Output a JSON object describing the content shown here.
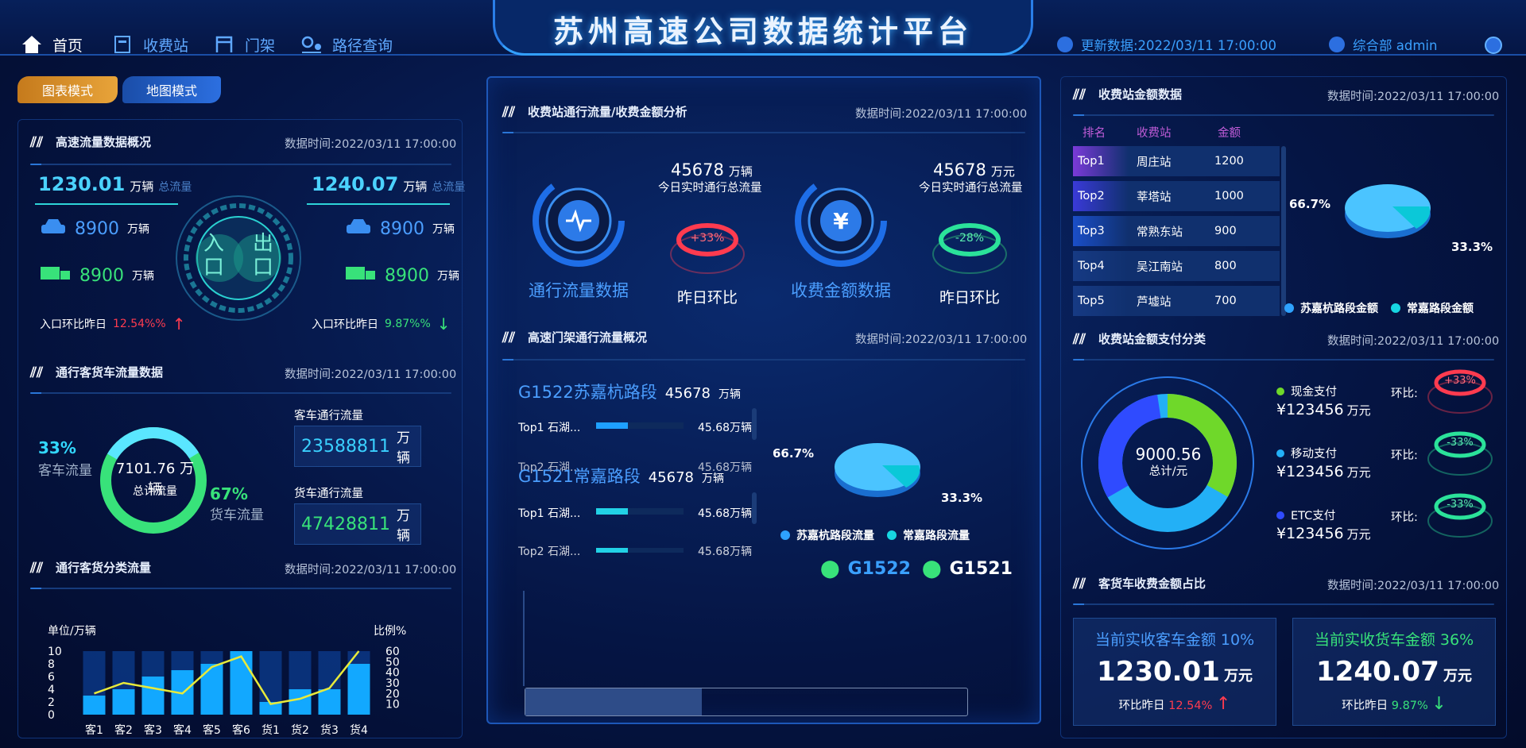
{
  "header": {
    "title": "苏州高速公司数据统计平台",
    "nav": [
      {
        "label": "首页"
      },
      {
        "label": "收费站"
      },
      {
        "label": "门架"
      },
      {
        "label": "路径查询"
      }
    ],
    "update_label": "更新数据:2022/03/11 17:00:00",
    "user": "综合部 admin"
  },
  "modes": {
    "chart": "图表模式",
    "map": "地图模式"
  },
  "left": {
    "overview": {
      "title": "高速流量数据概况",
      "time": "数据时间:2022/03/11 17:00:00",
      "in_total": "1230.01",
      "out_total": "1240.07",
      "unit": "万辆",
      "total_label": "总流量",
      "car_in": "8900",
      "car_out": "8900",
      "truck_in": "8900",
      "truck_out": "8900",
      "unit2": "万辆",
      "center_in": "入口",
      "center_out": "出口",
      "in_ratio_label": "入口环比昨日",
      "in_ratio": "12.54%%",
      "out_ratio_label": "入口环比昨日",
      "out_ratio": "9.87%%"
    },
    "pc": {
      "title": "通行客货车流量数据",
      "time": "数据时间:2022/03/11 17:00:00",
      "pass_pct": "33%",
      "pass_label": "客车流量",
      "truck_pct": "67%",
      "truck_label": "货车流量",
      "total": "7101.76 万辆",
      "total_label": "总计流量",
      "car_title": "客车通行流量",
      "car_val": "23588811",
      "truck_title": "货车通行流量",
      "truck_val": "47428811",
      "unit": "万辆"
    },
    "cls": {
      "title": "通行客货分类流量",
      "time": "数据时间:2022/03/11 17:00:00",
      "unit_l": "单位/万辆",
      "unit_r": "比例%"
    }
  },
  "center": {
    "flow": {
      "title": "收费站通行流量/收费金额分析",
      "time": "数据时间:2022/03/11 17:00:00",
      "v1": "45678",
      "u1": "万辆",
      "d1": "今日实时通行总流量",
      "v2": "45678",
      "u2": "万元",
      "d2": "今日实时通行总流量",
      "r1": "+33%",
      "r2": "-28%",
      "l1": "通行流量数据",
      "l2": "昨日环比",
      "l3": "收费金额数据",
      "l4": "昨日环比"
    },
    "gantry": {
      "title": "高速门架通行流量概况",
      "time": "数据时间:2022/03/11 17:00:00",
      "s1": "G1522苏嘉杭路段",
      "s1v": "45678",
      "s2": "G1521常嘉路段",
      "s2v": "45678",
      "unit": "万辆",
      "rows1": [
        {
          "n": "Top1 石湖...",
          "v": "45.68万辆"
        },
        {
          "n": "Top2 石湖...",
          "v": "45.68万辆"
        }
      ],
      "rows2": [
        {
          "n": "Top1 石湖...",
          "v": "45.68万辆"
        },
        {
          "n": "Top2 石湖...",
          "v": "45.68万辆"
        }
      ],
      "pie_a": "66.7%",
      "pie_b": "33.3%",
      "lg1": "苏嘉杭路段流量",
      "lg2": "常嘉路段流量",
      "m1": "G1522",
      "m2": "G1521"
    }
  },
  "right": {
    "amt": {
      "title": "收费站金额数据",
      "time": "数据时间:2022/03/11 17:00:00",
      "h": [
        "排名",
        "收费站",
        "金额"
      ],
      "rows": [
        {
          "r": "Top1",
          "s": "周庄站",
          "v": "1200"
        },
        {
          "r": "Top2",
          "s": "莘塔站",
          "v": "1000"
        },
        {
          "r": "Top3",
          "s": "常熟东站",
          "v": "900"
        },
        {
          "r": "Top4",
          "s": "吴江南站",
          "v": "800"
        },
        {
          "r": "Top5",
          "s": "芦墟站",
          "v": "700"
        }
      ],
      "pa": "66.7%",
      "pb": "33.3%",
      "lg1": "苏嘉杭路段金额",
      "lg2": "常嘉路段金额"
    },
    "pay": {
      "title": "收费站金额支付分类",
      "time": "数据时间:2022/03/11 17:00:00",
      "total": "9000.56",
      "total_label": "总计/元",
      "items": [
        {
          "n": "现金支付",
          "v": "¥123456",
          "u": "万元",
          "r": "+33%"
        },
        {
          "n": "移动支付",
          "v": "¥123456",
          "u": "万元",
          "r": "-33%"
        },
        {
          "n": "ETC支付",
          "v": "¥123456",
          "u": "万元",
          "r": "-33%"
        }
      ],
      "ring_label": "环比:"
    },
    "share": {
      "title": "客货车收费金额占比",
      "time": "数据时间:2022/03/11 17:00:00",
      "car_t": "当前实收客车金额",
      "car_p": "10%",
      "car_v": "1230.01",
      "truck_t": "当前实收货车金额",
      "truck_p": "36%",
      "truck_v": "1240.07",
      "unit": "万元",
      "r_label": "环比昨日",
      "r1": "12.54%",
      "r2": "9.87%"
    }
  },
  "chart_data": {
    "type": "bar",
    "categories": [
      "客1",
      "客2",
      "客3",
      "客4",
      "客5",
      "客6",
      "货1",
      "货2",
      "货3",
      "货4"
    ],
    "values": [
      3,
      4,
      6,
      7,
      8,
      10,
      2,
      4,
      4,
      8
    ],
    "line_values": [
      20,
      30,
      25,
      20,
      45,
      55,
      10,
      15,
      25,
      60
    ],
    "ylim": [
      0,
      10
    ],
    "y2lim": [
      0,
      60
    ],
    "yticks": [
      "0",
      "2",
      "4",
      "6",
      "8",
      "10"
    ],
    "y2ticks": [
      "10",
      "20",
      "30",
      "40",
      "50",
      "60"
    ],
    "ylabel": "单位/万辆",
    "y2label": "比例%"
  }
}
